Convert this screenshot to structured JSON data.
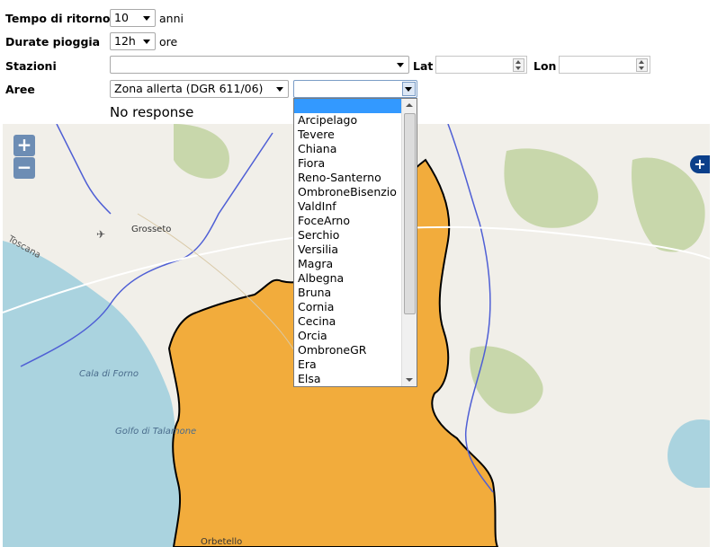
{
  "form": {
    "tempo": {
      "label": "Tempo di ritorno",
      "value": "10",
      "unit": "anni"
    },
    "durate": {
      "label": "Durate pioggia",
      "value": "12h",
      "unit": "ore"
    },
    "stazioni": {
      "label": "Stazioni",
      "value": "",
      "lat_label": "Lat",
      "lon_label": "Lon",
      "lat_value": "",
      "lon_value": ""
    },
    "aree": {
      "label": "Aree",
      "value": "Zona allerta (DGR 611/06)",
      "sub_value": ""
    },
    "status": "No response"
  },
  "dropdown": {
    "options": [
      "",
      "Arcipelago",
      "Tevere",
      "Chiana",
      "Fiora",
      "Reno-Santerno",
      "OmbroneBisenzio",
      "ValdInf",
      "FoceArno",
      "Serchio",
      "Versilia",
      "Magra",
      "Albegna",
      "Bruna",
      "Cornia",
      "Cecina",
      "Orcia",
      "OmbroneGR",
      "Era",
      "Elsa"
    ]
  },
  "map": {
    "zoom_in": "+",
    "zoom_out": "−",
    "layer_switcher": "+",
    "place_labels": {
      "grosseto": "Grosseto",
      "toscana": "Toscana",
      "cala_di_forno": "Cala di Forno",
      "golfo": "Golfo di Talamone",
      "orbetello": "Orbetello"
    },
    "colors": {
      "sea": "#aad3df",
      "zone": "#f2ac3c",
      "river": "#4f5fd5",
      "park": "#c8d7ab"
    }
  }
}
